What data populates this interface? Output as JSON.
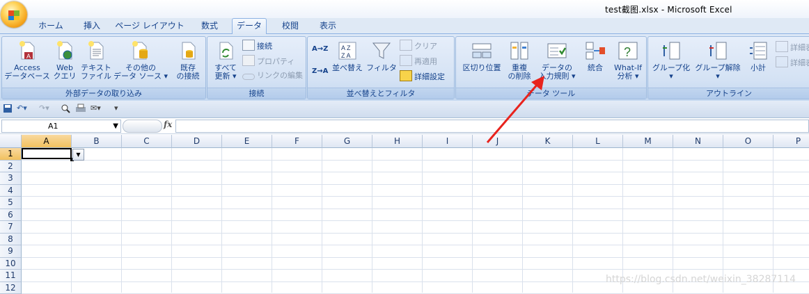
{
  "window": {
    "title": "test截图.xlsx - Microsoft Excel"
  },
  "tabs": [
    "ホーム",
    "挿入",
    "ページ レイアウト",
    "数式",
    "データ",
    "校閲",
    "表示"
  ],
  "active_tab": "データ",
  "ribbon": {
    "external": {
      "label": "外部データの取り込み",
      "access": [
        "Access",
        "データベース"
      ],
      "web": [
        "Web",
        "クエリ"
      ],
      "text": [
        "テキスト",
        "ファイル"
      ],
      "other": [
        "その他の",
        "データ ソース"
      ],
      "existing": [
        "既存",
        "の接続"
      ]
    },
    "connections": {
      "label": "接続",
      "refresh": [
        "すべて",
        "更新"
      ],
      "connect": "接続",
      "properties": "プロパティ",
      "edit_links": "リンクの編集"
    },
    "sort_filter": {
      "label": "並べ替えとフィルタ",
      "sort_az": "A→Z",
      "sort_za": "Z→A",
      "sort": "並べ替え",
      "filter": "フィルタ",
      "clear": "クリア",
      "reapply": "再適用",
      "advanced": "詳細設定"
    },
    "data_tools": {
      "label": "データ ツール",
      "text_to_columns": "区切り位置",
      "remove_dup": [
        "重複",
        "の削除"
      ],
      "validation": [
        "データの",
        "入力規則"
      ],
      "consolidate": "統合",
      "whatif": [
        "What-If",
        "分析"
      ]
    },
    "outline": {
      "label": "アウトライン",
      "group": "グループ化",
      "ungroup": "グループ解除",
      "subtotal": "小計",
      "detail_show": "詳細表",
      "detail_hide": "詳細表"
    }
  },
  "formula_bar": {
    "name_box": "A1",
    "fx": "fx",
    "formula": ""
  },
  "columns": [
    "A",
    "B",
    "C",
    "D",
    "E",
    "F",
    "G",
    "H",
    "I",
    "J",
    "K",
    "L",
    "M",
    "N",
    "O",
    "P"
  ],
  "rows": [
    "1",
    "2",
    "3",
    "4",
    "5",
    "6",
    "7",
    "8",
    "9",
    "10",
    "11",
    "12"
  ],
  "watermark": "https://blog.csdn.net/weixin_38287114",
  "colors": {
    "arrow": "#e8231d",
    "selection_header": "#f1c15f",
    "ribbon_text": "#15428b"
  }
}
